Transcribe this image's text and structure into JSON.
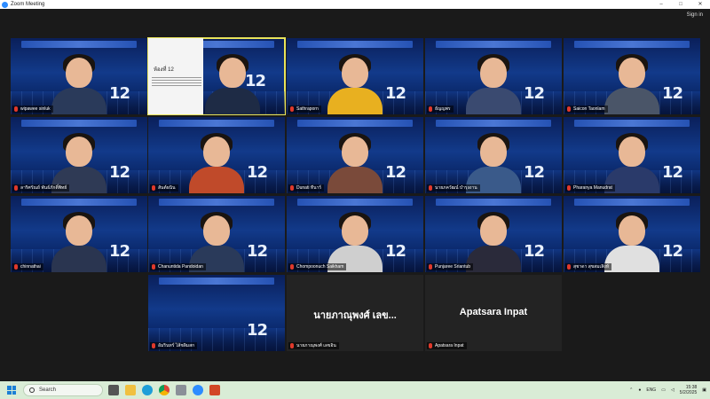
{
  "window": {
    "title": "Zoom Meeting",
    "sign_in": "Sign in"
  },
  "participants": [
    {
      "name": "wipawee sinluk"
    },
    {
      "name": "",
      "slide_title": "ห้องที่ 12"
    },
    {
      "name": "Sathraporn"
    },
    {
      "name": "ธัญญพร"
    },
    {
      "name": "Saicon Taonlam"
    },
    {
      "name": "ลาริศรัณย์ พันธ์ภักดิ์พิทย์"
    },
    {
      "name": "สันต์ธนิน"
    },
    {
      "name": "Dunati ทีนาร์"
    },
    {
      "name": "นายภควัฒน์ บำรุงงาน"
    },
    {
      "name": "Pharanya Manudrat"
    },
    {
      "name": "chinnathai"
    },
    {
      "name": "Chanuntida Pandoidan"
    },
    {
      "name": "Chompoonuch Saikham"
    },
    {
      "name": "Punjaree Sriantub"
    },
    {
      "name": "สุชาดา สุขสมเสิงห์"
    },
    {
      "name": "อัมรินทร์ ไส้ชลิมสก"
    },
    {
      "name": "นายภาณุพงศ์ เลขอิน",
      "display": "นายภาณุพงศ์ เลข..."
    },
    {
      "name": "Apatsara Inpat",
      "display": "Apatsara Inpat"
    }
  ],
  "badge_number": "12",
  "taskbar": {
    "search_placeholder": "Search",
    "language": "ENG",
    "time": "15:38",
    "date": "5/2/2025"
  },
  "colors": {
    "accent": "#2d8cff",
    "active_speaker": "#e8e35a",
    "taskbar": "#d9ecd6"
  }
}
